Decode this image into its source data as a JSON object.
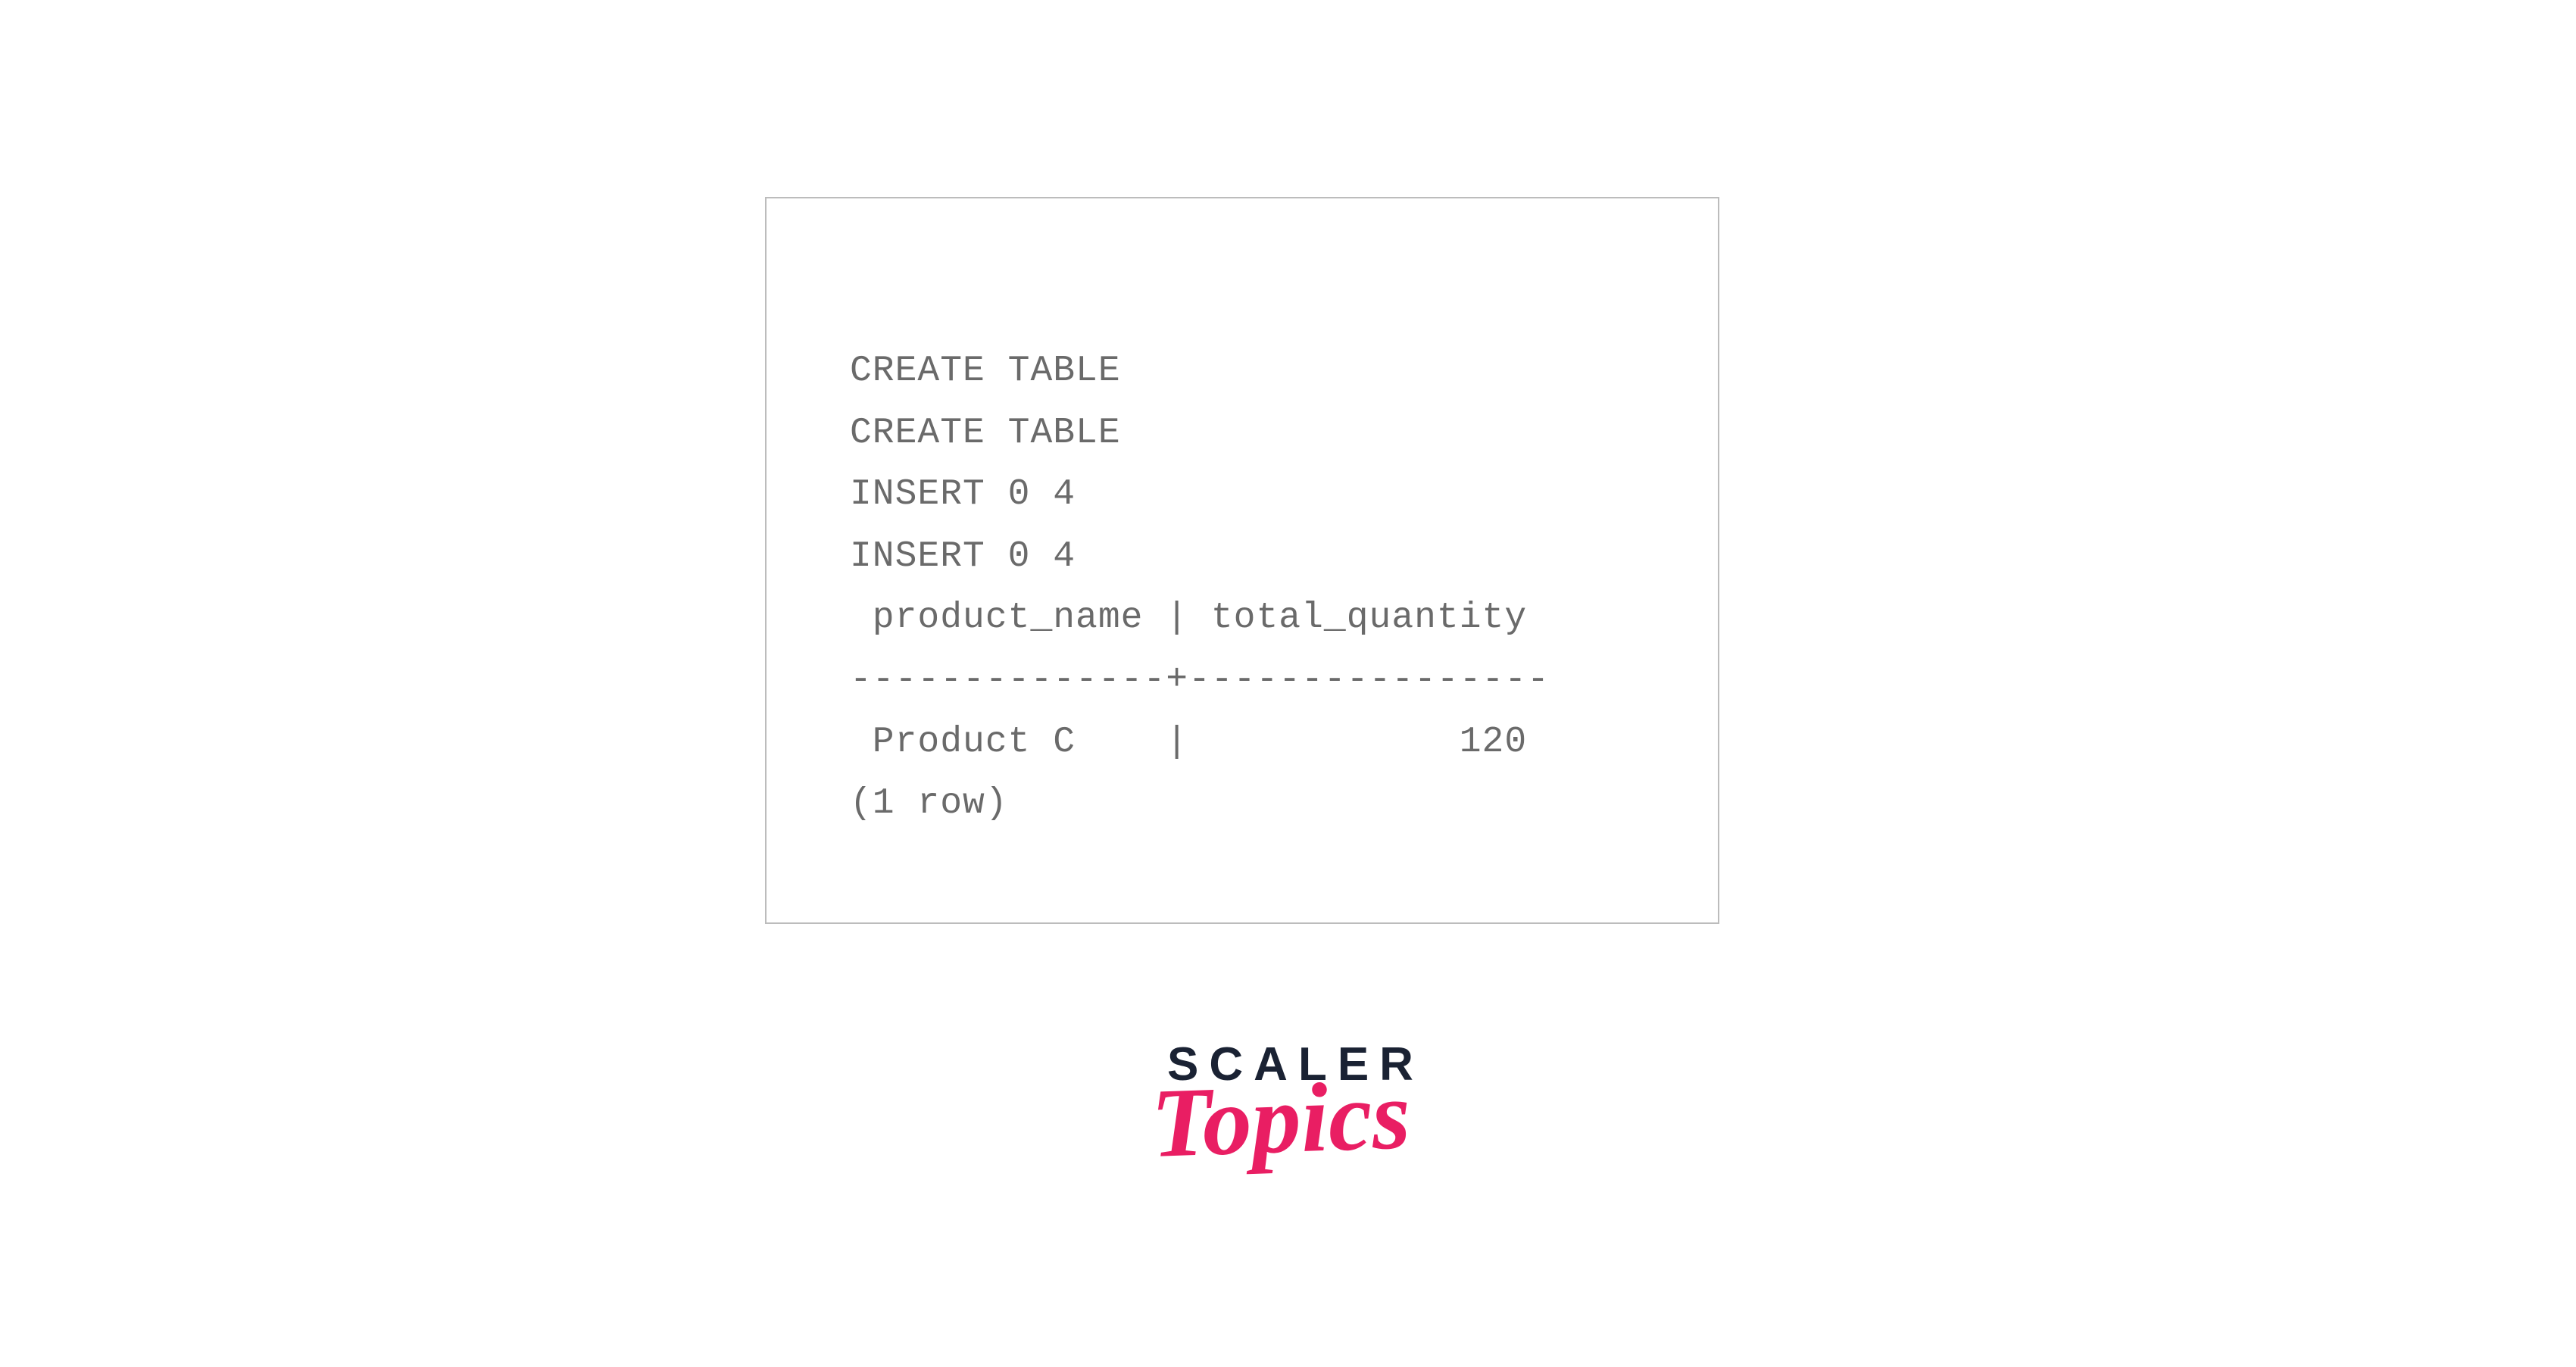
{
  "terminal": {
    "lines": [
      "CREATE TABLE",
      "CREATE TABLE",
      "INSERT 0 4",
      "INSERT 0 4",
      " product_name | total_quantity ",
      "--------------+----------------",
      " Product C    |            120",
      "(1 row)"
    ]
  },
  "brand": {
    "line1": "SCALER",
    "line2": "Topics"
  }
}
